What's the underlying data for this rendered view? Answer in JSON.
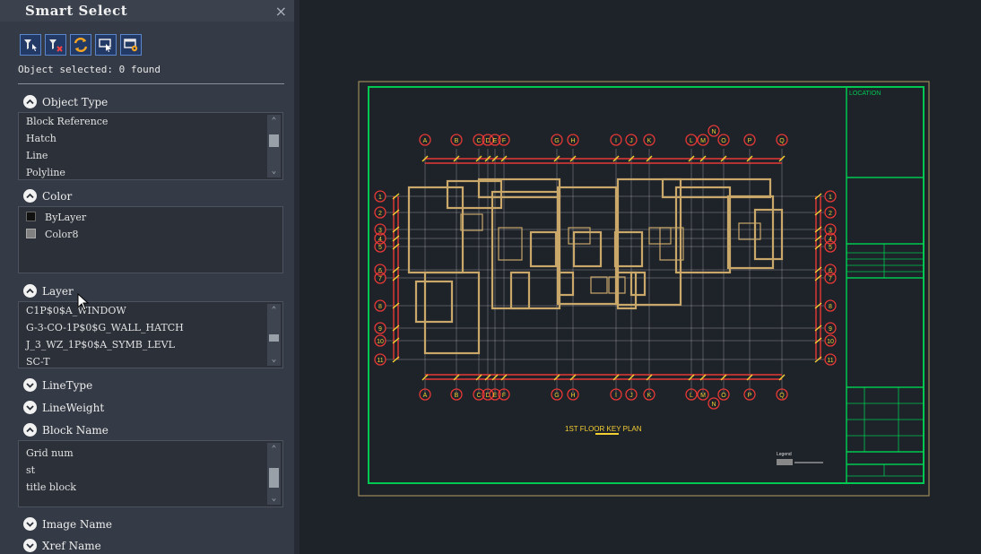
{
  "panel": {
    "title": "Smart Select",
    "close_glyph": "×",
    "toolbar": [
      {
        "name": "select-by-type-icon"
      },
      {
        "name": "clear-selection-icon"
      },
      {
        "name": "refresh-icon"
      },
      {
        "name": "select-objects-icon"
      },
      {
        "name": "settings-icon"
      }
    ],
    "status": "Object selected: 0 found",
    "sections": {
      "object_type": {
        "label": "Object Type",
        "items": [
          "Block Reference",
          "Hatch",
          "Line",
          "Polyline"
        ]
      },
      "color": {
        "label": "Color",
        "items": [
          {
            "label": "ByLayer",
            "swatch": "#111111"
          },
          {
            "label": "Color8",
            "swatch": "#808080"
          }
        ]
      },
      "layer": {
        "label": "Layer",
        "items": [
          "C1P$0$A_WINDOW",
          "G-3-CO-1P$0$G_WALL_HATCH",
          "J_3_WZ_1P$0$A_SYMB_LEVL",
          "SC-T"
        ]
      },
      "linetype": {
        "label": "LineType"
      },
      "lineweight": {
        "label": "LineWeight"
      },
      "block_name": {
        "label": "Block Name",
        "items": [
          "Grid num",
          "st",
          "title block"
        ]
      },
      "image_name": {
        "label": "Image Name"
      },
      "xref_name": {
        "label": "Xref Name"
      }
    }
  },
  "drawing": {
    "title_text": "1ST FLOOR KEY PLAN",
    "location_label": "LOCATION",
    "legend_label": "Legend",
    "grid_letters_top": [
      "A",
      "B",
      "C",
      "D",
      "E",
      "F",
      "G",
      "H",
      "I",
      "J",
      "K",
      "L",
      "M",
      "N",
      "O",
      "P",
      "Q"
    ],
    "grid_letters_bottom": [
      "A",
      "B",
      "C",
      "D",
      "E",
      "F",
      "G",
      "H",
      "I",
      "J",
      "K",
      "L",
      "M",
      "N",
      "O",
      "P",
      "Q"
    ],
    "grid_numbers_left": [
      "1",
      "2",
      "3",
      "4",
      "5",
      "6",
      "7",
      "8",
      "9",
      "10",
      "11"
    ],
    "grid_numbers_right": [
      "1",
      "2",
      "3",
      "4",
      "5",
      "6",
      "7",
      "8",
      "9",
      "10",
      "11"
    ],
    "colors": {
      "border": "#00c853",
      "frame": "#9b8a5a",
      "walls": "#c9a86a",
      "grid": "#c0c0c0",
      "dims": "#e53935",
      "bubbles": "#e53935",
      "text": "#f5d033"
    }
  }
}
